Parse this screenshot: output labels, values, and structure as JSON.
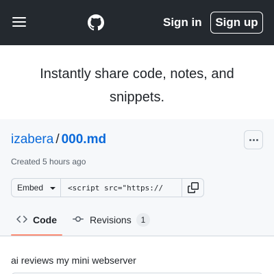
{
  "header": {
    "sign_in": "Sign in",
    "sign_up": "Sign up",
    "icons": {
      "menu": "hamburger-icon",
      "logo": "github-logo"
    }
  },
  "hero": {
    "text": "Instantly share code, notes, and snippets."
  },
  "gist": {
    "owner": "izabera",
    "separator": "/",
    "filename": "000.md",
    "created": "Created 5 hours ago",
    "embed": {
      "label": "Embed",
      "value": "<script src=\"https://"
    },
    "tabs": [
      {
        "label": "Code",
        "icon": "code-icon",
        "selected": true
      },
      {
        "label": "Revisions",
        "icon": "git-commit-icon",
        "count": "1"
      }
    ],
    "description": "ai reviews my mini webserver"
  },
  "colors": {
    "header_bg": "#24292f",
    "link": "#0969da",
    "tab_underline": "#fd8c73",
    "panel_bg": "#f6f8fa"
  }
}
